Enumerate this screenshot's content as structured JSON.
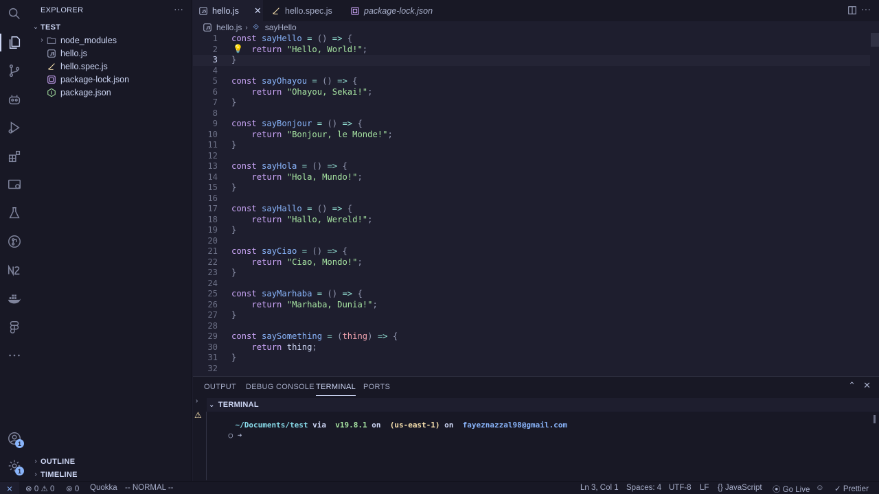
{
  "sidebar": {
    "title": "EXPLORER",
    "folder": "TEST",
    "files": [
      {
        "label": "node_modules",
        "kind": "folder"
      },
      {
        "label": "hello.js",
        "kind": "js"
      },
      {
        "label": "hello.spec.js",
        "kind": "spec"
      },
      {
        "label": "package-lock.json",
        "kind": "lock"
      },
      {
        "label": "package.json",
        "kind": "npm"
      }
    ],
    "outline": "OUTLINE",
    "timeline": "TIMELINE"
  },
  "activity": {
    "accounts_badge": "1",
    "settings_badge": "1"
  },
  "tabs": [
    {
      "label": "hello.js",
      "active": true
    },
    {
      "label": "hello.spec.js",
      "active": false
    },
    {
      "label": "package-lock.json",
      "active": false
    }
  ],
  "breadcrumb": {
    "file": "hello.js",
    "symbol": "sayHello"
  },
  "editor": {
    "current_line": 3,
    "lines": [
      {
        "n": "1",
        "tokens": [
          [
            "kw",
            "const "
          ],
          [
            "fn",
            "sayHello"
          ],
          [
            "op",
            " = "
          ],
          [
            "pun",
            "() "
          ],
          [
            "op",
            "=> "
          ],
          [
            "pun",
            "{"
          ]
        ]
      },
      {
        "n": "2",
        "tokens": [
          [
            "txt",
            "    "
          ],
          [
            "kw",
            "return "
          ],
          [
            "str",
            "\"Hello, World!\""
          ],
          [
            "pun",
            ";"
          ]
        ]
      },
      {
        "n": "3",
        "tokens": [
          [
            "pun",
            "}"
          ]
        ]
      },
      {
        "n": "4",
        "tokens": []
      },
      {
        "n": "5",
        "tokens": [
          [
            "kw",
            "const "
          ],
          [
            "fn",
            "sayOhayou"
          ],
          [
            "op",
            " = "
          ],
          [
            "pun",
            "() "
          ],
          [
            "op",
            "=> "
          ],
          [
            "pun",
            "{"
          ]
        ]
      },
      {
        "n": "6",
        "tokens": [
          [
            "txt",
            "    "
          ],
          [
            "kw",
            "return "
          ],
          [
            "str",
            "\"Ohayou, Sekai!\""
          ],
          [
            "pun",
            ";"
          ]
        ]
      },
      {
        "n": "7",
        "tokens": [
          [
            "pun",
            "}"
          ]
        ]
      },
      {
        "n": "8",
        "tokens": []
      },
      {
        "n": "9",
        "tokens": [
          [
            "kw",
            "const "
          ],
          [
            "fn",
            "sayBonjour"
          ],
          [
            "op",
            " = "
          ],
          [
            "pun",
            "() "
          ],
          [
            "op",
            "=> "
          ],
          [
            "pun",
            "{"
          ]
        ]
      },
      {
        "n": "10",
        "tokens": [
          [
            "txt",
            "    "
          ],
          [
            "kw",
            "return "
          ],
          [
            "str",
            "\"Bonjour, le Monde!\""
          ],
          [
            "pun",
            ";"
          ]
        ]
      },
      {
        "n": "11",
        "tokens": [
          [
            "pun",
            "}"
          ]
        ]
      },
      {
        "n": "12",
        "tokens": []
      },
      {
        "n": "13",
        "tokens": [
          [
            "kw",
            "const "
          ],
          [
            "fn",
            "sayHola"
          ],
          [
            "op",
            " = "
          ],
          [
            "pun",
            "() "
          ],
          [
            "op",
            "=> "
          ],
          [
            "pun",
            "{"
          ]
        ]
      },
      {
        "n": "14",
        "tokens": [
          [
            "txt",
            "    "
          ],
          [
            "kw",
            "return "
          ],
          [
            "str",
            "\"Hola, Mundo!\""
          ],
          [
            "pun",
            ";"
          ]
        ]
      },
      {
        "n": "15",
        "tokens": [
          [
            "pun",
            "}"
          ]
        ]
      },
      {
        "n": "16",
        "tokens": []
      },
      {
        "n": "17",
        "tokens": [
          [
            "kw",
            "const "
          ],
          [
            "fn",
            "sayHallo"
          ],
          [
            "op",
            " = "
          ],
          [
            "pun",
            "() "
          ],
          [
            "op",
            "=> "
          ],
          [
            "pun",
            "{"
          ]
        ]
      },
      {
        "n": "18",
        "tokens": [
          [
            "txt",
            "    "
          ],
          [
            "kw",
            "return "
          ],
          [
            "str",
            "\"Hallo, Wereld!\""
          ],
          [
            "pun",
            ";"
          ]
        ]
      },
      {
        "n": "19",
        "tokens": [
          [
            "pun",
            "}"
          ]
        ]
      },
      {
        "n": "20",
        "tokens": []
      },
      {
        "n": "21",
        "tokens": [
          [
            "kw",
            "const "
          ],
          [
            "fn",
            "sayCiao"
          ],
          [
            "op",
            " = "
          ],
          [
            "pun",
            "() "
          ],
          [
            "op",
            "=> "
          ],
          [
            "pun",
            "{"
          ]
        ]
      },
      {
        "n": "22",
        "tokens": [
          [
            "txt",
            "    "
          ],
          [
            "kw",
            "return "
          ],
          [
            "str",
            "\"Ciao, Mondo!\""
          ],
          [
            "pun",
            ";"
          ]
        ]
      },
      {
        "n": "23",
        "tokens": [
          [
            "pun",
            "}"
          ]
        ]
      },
      {
        "n": "24",
        "tokens": []
      },
      {
        "n": "25",
        "tokens": [
          [
            "kw",
            "const "
          ],
          [
            "fn",
            "sayMarhaba"
          ],
          [
            "op",
            " = "
          ],
          [
            "pun",
            "() "
          ],
          [
            "op",
            "=> "
          ],
          [
            "pun",
            "{"
          ]
        ]
      },
      {
        "n": "26",
        "tokens": [
          [
            "txt",
            "    "
          ],
          [
            "kw",
            "return "
          ],
          [
            "str",
            "\"Marhaba, Dunia!\""
          ],
          [
            "pun",
            ";"
          ]
        ]
      },
      {
        "n": "27",
        "tokens": [
          [
            "pun",
            "}"
          ]
        ]
      },
      {
        "n": "28",
        "tokens": []
      },
      {
        "n": "29",
        "tokens": [
          [
            "kw",
            "const "
          ],
          [
            "fn",
            "saySomething"
          ],
          [
            "op",
            " = "
          ],
          [
            "pun",
            "("
          ],
          [
            "prm",
            "thing"
          ],
          [
            "pun",
            ") "
          ],
          [
            "op",
            "=> "
          ],
          [
            "pun",
            "{"
          ]
        ]
      },
      {
        "n": "30",
        "tokens": [
          [
            "txt",
            "    "
          ],
          [
            "kw",
            "return "
          ],
          [
            "txt",
            "thing"
          ],
          [
            "pun",
            ";"
          ]
        ]
      },
      {
        "n": "31",
        "tokens": [
          [
            "pun",
            "}"
          ]
        ]
      },
      {
        "n": "32",
        "tokens": []
      }
    ]
  },
  "panel": {
    "tabs": [
      "OUTPUT",
      "DEBUG CONSOLE",
      "TERMINAL",
      "PORTS"
    ],
    "active_tab": "TERMINAL",
    "terminal_title": "TERMINAL",
    "prompt": {
      "path": "~/Documents/test",
      "via": " via ",
      "node": " v19.8.1",
      "on1": " on ",
      "region": " (us-east-1)",
      "on2": " on ",
      "account": " fayeznazzal98@gmail.com",
      "arrow": "➜"
    }
  },
  "status": {
    "errors": "0",
    "warnings": "0",
    "ports": "0",
    "quokka": "Quokka",
    "mode": "-- NORMAL --",
    "position": "Ln 3, Col 1",
    "spaces": "Spaces: 4",
    "encoding": "UTF-8",
    "eol": "LF",
    "language": "JavaScript",
    "golive": "Go Live",
    "prettier": "Prettier"
  }
}
